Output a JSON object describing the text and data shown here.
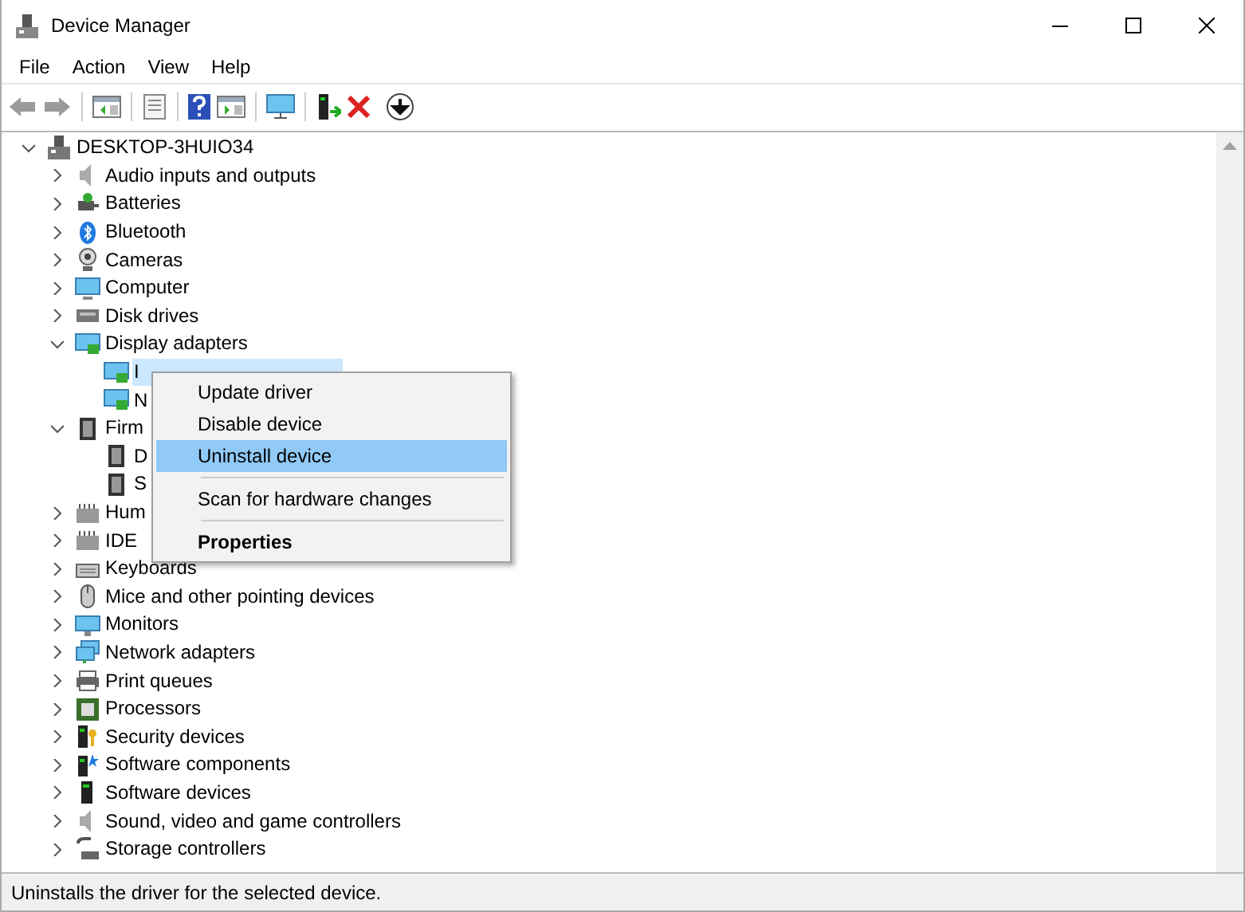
{
  "window": {
    "title": "Device Manager"
  },
  "menu_bar": [
    "File",
    "Action",
    "View",
    "Help"
  ],
  "tree": {
    "label": "DESKTOP-3HUIO34",
    "expanded": true,
    "selected": false,
    "children": [
      {
        "label": "Audio inputs and outputs",
        "expanded": false,
        "selected": false
      },
      {
        "label": "Batteries",
        "expanded": false,
        "selected": false
      },
      {
        "label": "Bluetooth",
        "expanded": false,
        "selected": false
      },
      {
        "label": "Cameras",
        "expanded": false,
        "selected": false
      },
      {
        "label": "Computer",
        "expanded": false,
        "selected": false
      },
      {
        "label": "Disk drives",
        "expanded": false,
        "selected": false
      },
      {
        "label": "Display adapters",
        "expanded": true,
        "selected": false,
        "children": [
          {
            "label": "I",
            "selected": true
          },
          {
            "label": "N",
            "selected": false
          }
        ]
      },
      {
        "label": "Firm",
        "expanded": true,
        "selected": false,
        "children": [
          {
            "label": "D",
            "selected": false
          },
          {
            "label": "S",
            "selected": false
          }
        ]
      },
      {
        "label": "Hum",
        "expanded": false,
        "selected": false
      },
      {
        "label": "IDE",
        "expanded": false,
        "selected": false
      },
      {
        "label": "Keyboards",
        "expanded": false,
        "selected": false
      },
      {
        "label": "Mice and other pointing devices",
        "expanded": false,
        "selected": false
      },
      {
        "label": "Monitors",
        "expanded": false,
        "selected": false
      },
      {
        "label": "Network adapters",
        "expanded": false,
        "selected": false
      },
      {
        "label": "Print queues",
        "expanded": false,
        "selected": false
      },
      {
        "label": "Processors",
        "expanded": false,
        "selected": false
      },
      {
        "label": "Security devices",
        "expanded": false,
        "selected": false
      },
      {
        "label": "Software components",
        "expanded": false,
        "selected": false
      },
      {
        "label": "Software devices",
        "expanded": false,
        "selected": false
      },
      {
        "label": "Sound, video and game controllers",
        "expanded": false,
        "selected": false
      },
      {
        "label": "Storage controllers",
        "expanded": false,
        "selected": false
      }
    ]
  },
  "context_menu": [
    {
      "label": "Update driver",
      "selected": false,
      "separator_above": false,
      "bold": false
    },
    {
      "label": "Disable device",
      "selected": false,
      "separator_above": false,
      "bold": false
    },
    {
      "label": "Uninstall device",
      "selected": true,
      "separator_above": false,
      "bold": false
    },
    {
      "label": "Scan for hardware changes",
      "selected": false,
      "separator_above": true,
      "bold": false
    },
    {
      "label": "Properties",
      "selected": false,
      "separator_above": true,
      "bold": true
    }
  ],
  "status_bar": "Uninstalls the driver for the selected device."
}
